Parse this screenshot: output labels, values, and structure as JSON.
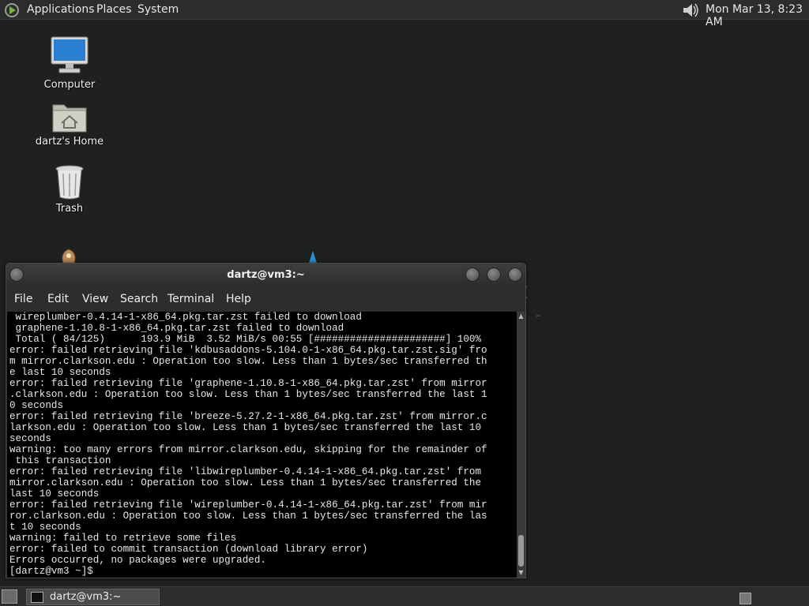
{
  "top_panel": {
    "menus": [
      "Applications",
      "Places",
      "System"
    ],
    "clock": "Mon Mar 13,  8:23 AM",
    "icons": {
      "menu": "distro-logo-icon",
      "volume": "speaker-icon"
    }
  },
  "desktop": {
    "icons": [
      {
        "label": "Computer",
        "icon": "computer-icon"
      },
      {
        "label": "dartz's Home",
        "icon": "home-folder-icon"
      },
      {
        "label": "Trash",
        "icon": "trash-icon"
      }
    ]
  },
  "terminal": {
    "title": "dartz@vm3:~",
    "menu": [
      "File",
      "Edit",
      "View",
      "Search",
      "Terminal",
      "Help"
    ],
    "lines": [
      " wireplumber-0.4.14-1-x86_64.pkg.tar.zst failed to download",
      " graphene-1.10.8-1-x86_64.pkg.tar.zst failed to download",
      " Total ( 84/125)      193.9 MiB  3.52 MiB/s 00:55 [######################] 100%",
      "error: failed retrieving file 'kdbusaddons-5.104.0-1-x86_64.pkg.tar.zst.sig' fro",
      "m mirror.clarkson.edu : Operation too slow. Less than 1 bytes/sec transferred th",
      "e last 10 seconds",
      "error: failed retrieving file 'graphene-1.10.8-1-x86_64.pkg.tar.zst' from mirror",
      ".clarkson.edu : Operation too slow. Less than 1 bytes/sec transferred the last 1",
      "0 seconds",
      "error: failed retrieving file 'breeze-5.27.2-1-x86_64.pkg.tar.zst' from mirror.c",
      "larkson.edu : Operation too slow. Less than 1 bytes/sec transferred the last 10",
      "seconds",
      "warning: too many errors from mirror.clarkson.edu, skipping for the remainder of",
      " this transaction",
      "error: failed retrieving file 'libwireplumber-0.4.14-1-x86_64.pkg.tar.zst' from",
      "mirror.clarkson.edu : Operation too slow. Less than 1 bytes/sec transferred the",
      "last 10 seconds",
      "error: failed retrieving file 'wireplumber-0.4.14-1-x86_64.pkg.tar.zst' from mir",
      "ror.clarkson.edu : Operation too slow. Less than 1 bytes/sec transferred the las",
      "t 10 seconds",
      "warning: failed to retrieve some files",
      "error: failed to commit transaction (download library error)",
      "Errors occurred, no packages were upgraded.",
      "[dartz@vm3 ~]$ "
    ]
  },
  "taskbar": {
    "items": [
      {
        "label": "dartz@vm3:~",
        "icon": "terminal-icon"
      }
    ]
  },
  "colors": {
    "panel": "#2b2d2c",
    "desktop": "#1f2120",
    "terminal_bg": "#000000",
    "accent": "#2d8fd3"
  }
}
